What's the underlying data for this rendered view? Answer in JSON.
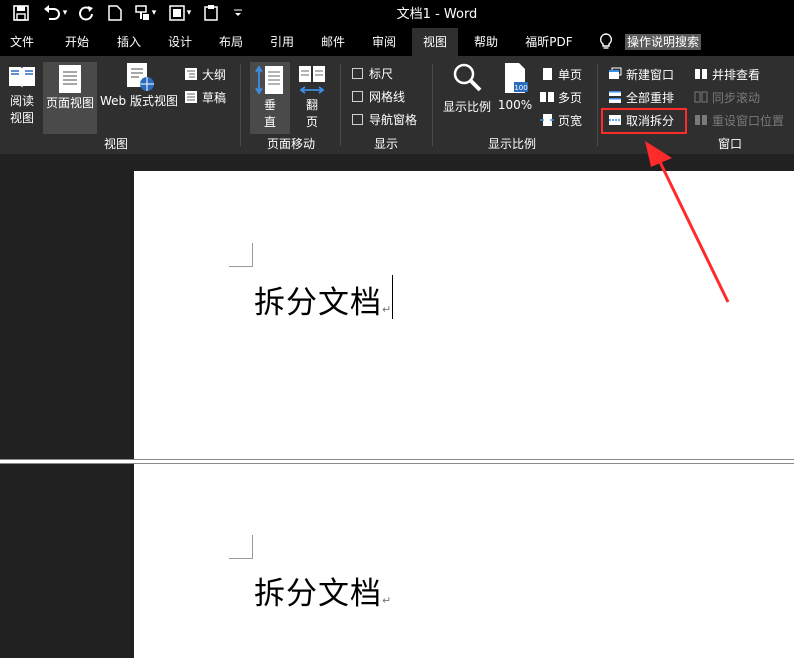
{
  "window": {
    "title": "文档1  -  Word"
  },
  "quick_access": [
    {
      "icon": "save-icon"
    },
    {
      "icon": "undo-icon"
    },
    {
      "icon": "redo-icon"
    },
    {
      "icon": "new-document-icon"
    },
    {
      "icon": "format-painter-icon"
    },
    {
      "icon": "save-as-icon"
    },
    {
      "icon": "clipboard-icon"
    },
    {
      "icon": "customize-quick-access-icon"
    }
  ],
  "tabs": [
    {
      "label": "文件"
    },
    {
      "label": "开始"
    },
    {
      "label": "插入"
    },
    {
      "label": "设计"
    },
    {
      "label": "布局"
    },
    {
      "label": "引用"
    },
    {
      "label": "邮件"
    },
    {
      "label": "审阅"
    },
    {
      "label": "视图",
      "active": true
    },
    {
      "label": "帮助"
    },
    {
      "label": "福昕PDF"
    }
  ],
  "tell_me": {
    "label": "操作说明搜索",
    "icon": "lightbulb-icon"
  },
  "ribbon": {
    "views": {
      "group_label": "视图",
      "read_mode": "阅读\n视图",
      "read_mode_l1": "阅读",
      "read_mode_l2": "视图",
      "print_layout": "页面视图",
      "web_layout": "Web 版式视图",
      "outline": "大纲",
      "draft": "草稿"
    },
    "page_movement": {
      "group_label": "页面移动",
      "vertical_l1": "垂",
      "vertical_l2": "直",
      "side_l1": "翻",
      "side_l2": "页"
    },
    "show": {
      "group_label": "显示",
      "ruler": "标尺",
      "gridlines": "网格线",
      "nav_pane": "导航窗格",
      "ruler_checked": false,
      "gridlines_checked": false,
      "nav_pane_checked": false
    },
    "zoom": {
      "group_label": "显示比例",
      "zoom": "显示比例",
      "hundred": "100%",
      "one_page": "单页",
      "multi_page": "多页",
      "page_width": "页宽"
    },
    "window": {
      "group_label": "窗口",
      "new_window": "新建窗口",
      "arrange_all": "全部重排",
      "remove_split": "取消拆分",
      "side_by_side": "并排查看",
      "sync_scroll": "同步滚动",
      "reset_position": "重设窗口位置"
    }
  },
  "document": {
    "top_pane_text": "拆分文档",
    "bottom_pane_text": "拆分文档"
  },
  "colors": {
    "highlight": "#ff2a2a",
    "arrow": "#ff2a2a",
    "ribbon_bg": "#2f2f2f",
    "titlebar_bg": "#000000"
  }
}
